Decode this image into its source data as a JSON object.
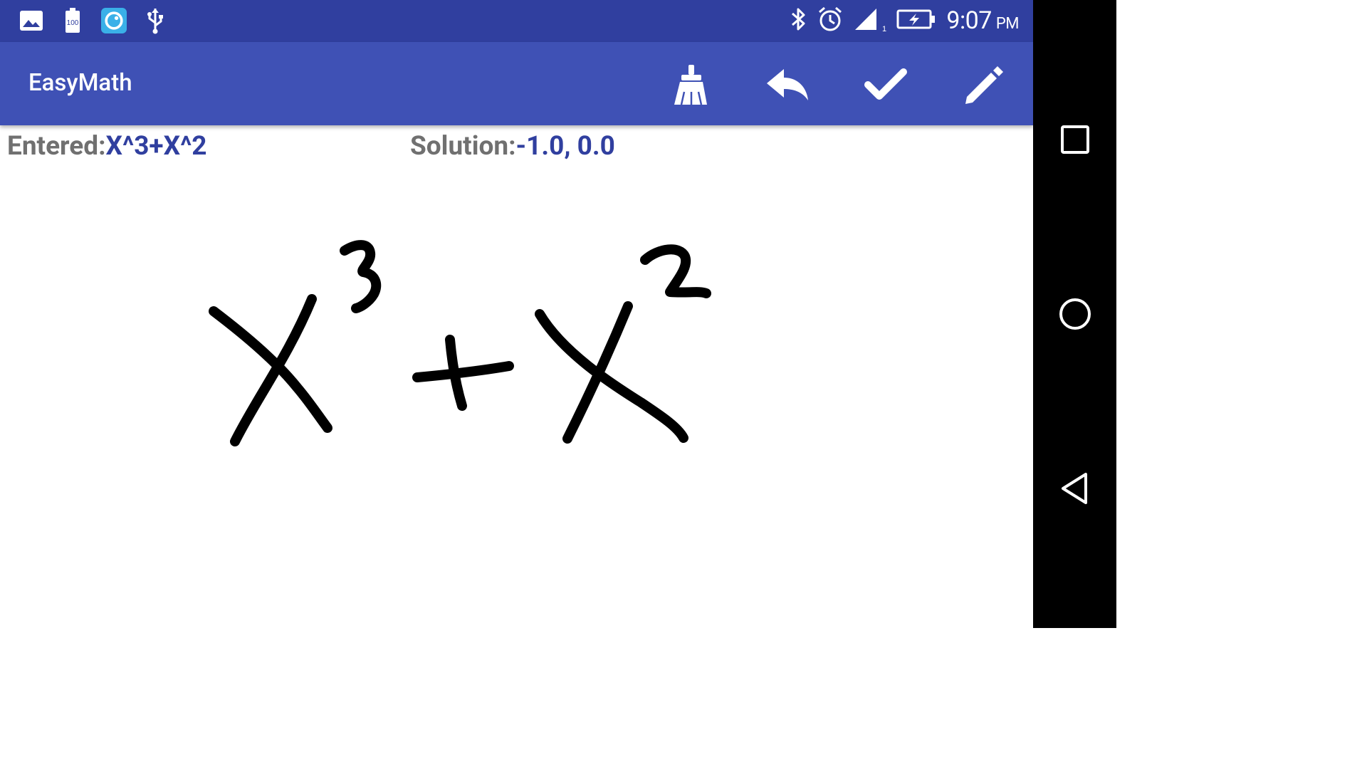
{
  "status_bar": {
    "left_icons": [
      "image-icon",
      "battery-100-icon",
      "app-notification-icon",
      "usb-icon"
    ],
    "right_icons": [
      "bluetooth-icon",
      "alarm-icon",
      "signal-icon",
      "battery-charging-icon"
    ],
    "time": "9:07",
    "ampm": "PM"
  },
  "app_bar": {
    "title": "EasyMath",
    "actions": [
      "broom-clear-icon",
      "undo-icon",
      "check-icon",
      "pencil-icon"
    ]
  },
  "info": {
    "entered_label": "Entered:",
    "entered_value": "X^3+X^2",
    "solution_label": "Solution:",
    "solution_value": "-1.0, 0.0"
  },
  "canvas": {
    "handwriting_text": "X³+X²"
  },
  "nav_bar": {
    "buttons": [
      "recents-icon",
      "home-icon",
      "back-icon"
    ]
  },
  "colors": {
    "status_bar": "#303f9f",
    "app_bar": "#3f51b5",
    "label_gray": "#707070",
    "value_blue": "#303f9f",
    "ink": "#000000"
  }
}
